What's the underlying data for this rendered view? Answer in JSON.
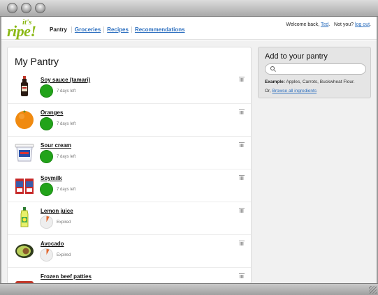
{
  "logo": {
    "small": "it's",
    "big": "ripe!"
  },
  "nav": [
    {
      "label": "Pantry",
      "current": true
    },
    {
      "label": "Groceries",
      "current": false
    },
    {
      "label": "Recipes",
      "current": false
    },
    {
      "label": "Recommendations",
      "current": false
    }
  ],
  "user": {
    "welcome": "Welcome back,",
    "name": "Ted",
    "not_you": "Not you?",
    "logout": "log out"
  },
  "pantry": {
    "title": "My Pantry",
    "items": [
      {
        "name": "Soy sauce (tamari)",
        "status": "7 days left",
        "expired": false,
        "icon": "soy-sauce-bottle"
      },
      {
        "name": "Oranges",
        "status": "7 days left",
        "expired": false,
        "icon": "orange"
      },
      {
        "name": "Sour cream",
        "status": "7 days left",
        "expired": false,
        "icon": "sour-cream-tub"
      },
      {
        "name": "Soymilk",
        "status": "7 days left",
        "expired": false,
        "icon": "soymilk-cartons"
      },
      {
        "name": "Lemon juice",
        "status": "Expired",
        "expired": true,
        "icon": "lemon-juice-bottle"
      },
      {
        "name": "Avocado",
        "status": "Expired",
        "expired": true,
        "icon": "avocado"
      },
      {
        "name": "Frozen beef patties",
        "status": "",
        "expired": false,
        "icon": "beef-patties"
      }
    ]
  },
  "add": {
    "title": "Add to your pantry",
    "search_placeholder": "",
    "example_label": "Example:",
    "example_text": "Apples, Carrots, Buckwheat Flour.",
    "browse_prefix": "Or,",
    "browse_link": "Browse all ingredients"
  },
  "colors": {
    "brand": "#8ab814",
    "link": "#2c6fbf",
    "fresh": "#22a31a",
    "expired": "#e2682e"
  }
}
